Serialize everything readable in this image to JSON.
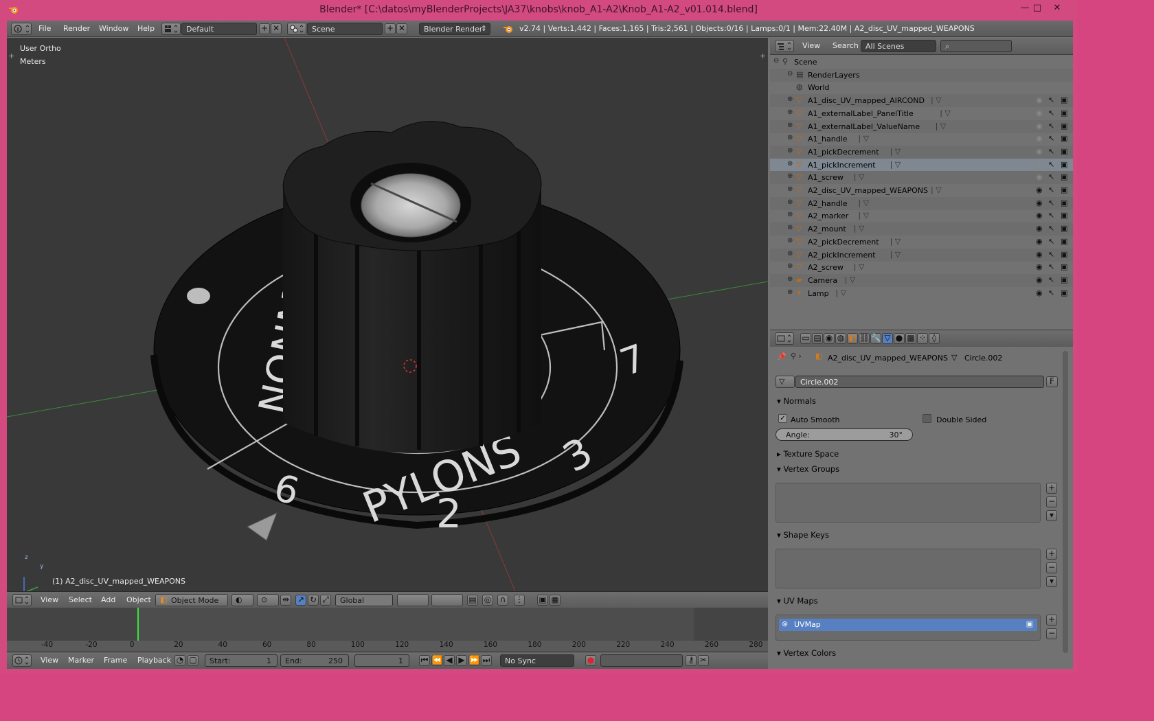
{
  "window": {
    "title": "Blender* [C:\\datos\\myBlenderProjects\\JA37\\knobs\\knob_A1-A2\\Knob_A1-A2_v01.014.blend]",
    "minimize": "—",
    "maximize": "□",
    "close": "✕"
  },
  "info_header": {
    "menus": [
      "File",
      "Render",
      "Window",
      "Help"
    ],
    "screen_layout": "Default",
    "scene": "Scene",
    "engine": "Blender Render",
    "stats": "v2.74 | Verts:1,442 | Faces:1,165 | Tris:2,561 | Objects:0/16 | Lamps:0/1 | Mem:22.40M | A2_disc_UV_mapped_WEAPONS"
  },
  "viewport": {
    "view_name": "User Ortho",
    "units": "Meters",
    "active_object": "(1) A2_disc_UV_mapped_WEAPONS",
    "axis_y": "y",
    "axis_z": "z",
    "dial_text": {
      "word1": "PYLONS",
      "word2": "NONM",
      "num2": "2",
      "num3": "3",
      "num6": "6",
      "num7": "7"
    }
  },
  "view3d_header": {
    "menus": [
      "View",
      "Select",
      "Add",
      "Object"
    ],
    "mode": "Object Mode",
    "orientation": "Global"
  },
  "timeline": {
    "ticks": [
      "-40",
      "-20",
      "0",
      "20",
      "40",
      "60",
      "80",
      "100",
      "120",
      "140",
      "160",
      "180",
      "200",
      "220",
      "240",
      "260",
      "280"
    ],
    "menus": [
      "View",
      "Marker",
      "Frame",
      "Playback"
    ],
    "start_label": "Start:",
    "start_value": "1",
    "end_label": "End:",
    "end_value": "250",
    "current_frame": "1",
    "sync": "No Sync"
  },
  "outliner": {
    "menus": [
      "View",
      "Search"
    ],
    "scenes_dropdown": "All Scenes",
    "items": [
      {
        "label": "Scene",
        "level": 0
      },
      {
        "label": "RenderLayers",
        "level": 1
      },
      {
        "label": "World",
        "level": 1
      },
      {
        "label": "A1_disc_UV_mapped_AIRCOND",
        "level": 1
      },
      {
        "label": "A1_externalLabel_PanelTitle",
        "level": 1
      },
      {
        "label": "A1_externalLabel_ValueName",
        "level": 1
      },
      {
        "label": "A1_handle",
        "level": 1
      },
      {
        "label": "A1_pickDecrement",
        "level": 1
      },
      {
        "label": "A1_pickIncrement",
        "level": 1
      },
      {
        "label": "A1_screw",
        "level": 1
      },
      {
        "label": "A2_disc_UV_mapped_WEAPONS",
        "level": 1
      },
      {
        "label": "A2_handle",
        "level": 1
      },
      {
        "label": "A2_marker",
        "level": 1
      },
      {
        "label": "A2_mount",
        "level": 1
      },
      {
        "label": "A2_pickDecrement",
        "level": 1
      },
      {
        "label": "A2_pickIncrement",
        "level": 1
      },
      {
        "label": "A2_screw",
        "level": 1
      },
      {
        "label": "Camera",
        "level": 1
      },
      {
        "label": "Lamp",
        "level": 1
      }
    ]
  },
  "properties": {
    "breadcrumb_object": "A2_disc_UV_mapped_WEAPONS",
    "breadcrumb_data": "Circle.002",
    "datablock_name": "Circle.002",
    "fake_user": "F",
    "panels": {
      "normals": "Normals",
      "auto_smooth": "Auto Smooth",
      "double_sided": "Double Sided",
      "angle_label": "Angle:",
      "angle_value": "30°",
      "texture_space": "Texture Space",
      "vertex_groups": "Vertex Groups",
      "shape_keys": "Shape Keys",
      "uv_maps": "UV Maps",
      "uv_map_item": "UVMap",
      "vertex_colors": "Vertex Colors"
    }
  },
  "colors": {
    "window_frame": "#d24a80",
    "ui_gray": "#727272",
    "viewport_bg": "#393939",
    "selection_blue": "#5680c2",
    "frame_cursor": "#3fe03f"
  }
}
